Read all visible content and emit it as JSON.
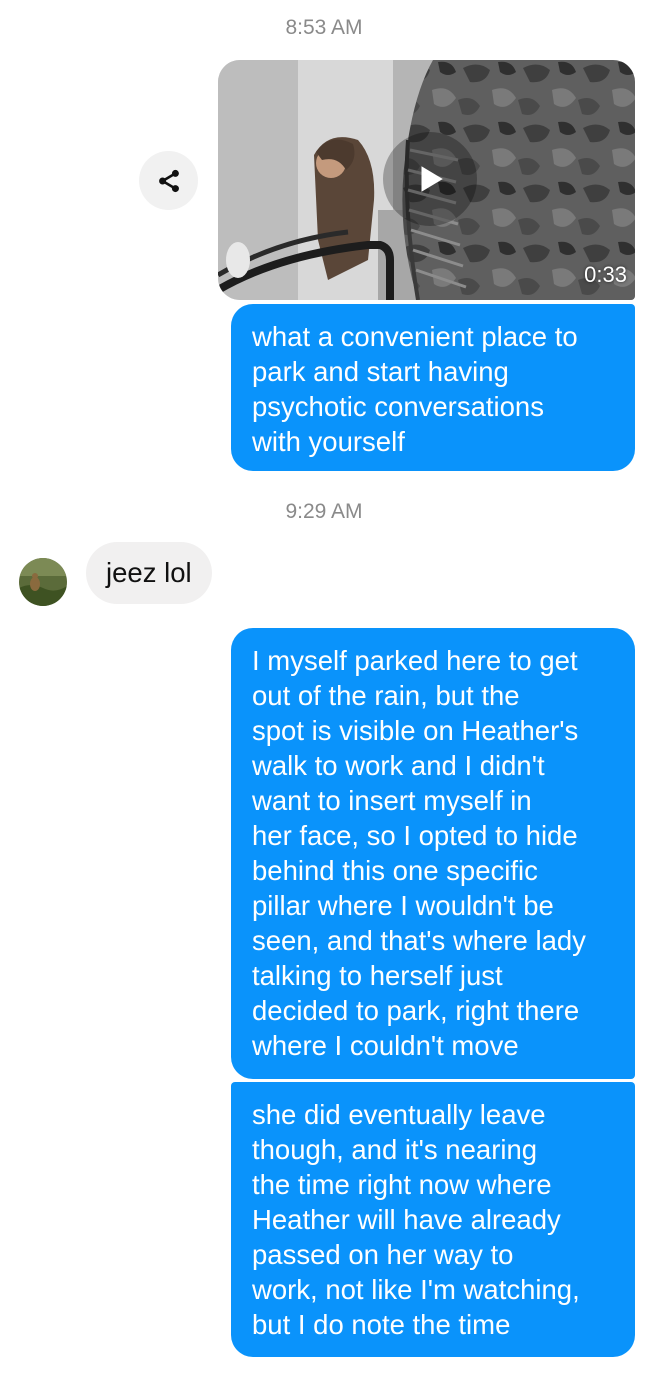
{
  "timestamps": [
    "8:53 AM",
    "9:29 AM"
  ],
  "share_icon": "share-icon",
  "video": {
    "duration": "0:33",
    "play_icon": "play-icon"
  },
  "messages": [
    {
      "sender": "me",
      "lines": [
        "what a convenient place to",
        "park and start having",
        "psychotic conversations",
        "with yourself"
      ]
    },
    {
      "sender": "them",
      "lines": [
        "jeez lol"
      ]
    },
    {
      "sender": "me",
      "lines": [
        "I myself parked here to get",
        "out of the rain, but the",
        "spot is visible on Heather's",
        "walk to work and I didn't",
        "want to insert myself in",
        "her face, so I opted to hide",
        "behind this one specific",
        "pillar where I wouldn't be",
        "seen, and that's where lady",
        "talking to herself just",
        "decided to park, right there",
        "where I couldn't move"
      ]
    },
    {
      "sender": "me",
      "lines": [
        "she did eventually leave",
        "though, and it's nearing",
        "the time right now where",
        "Heather will have already",
        "passed on her way to",
        "work, not like I'm watching,",
        "but I do note the time"
      ]
    }
  ],
  "colors": {
    "outgoing_bubble": "#0a93fb",
    "incoming_bubble": "#f1f0f0",
    "timestamp_text": "#8a8a8a"
  }
}
